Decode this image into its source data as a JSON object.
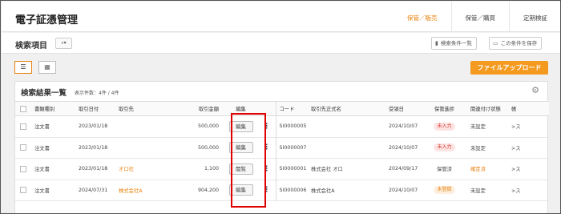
{
  "header": {
    "title": "電子証憑管理",
    "nav": [
      {
        "label": "保管／販売",
        "active": true
      },
      {
        "label": "保管／購買",
        "active": false
      },
      {
        "label": "定期検証",
        "active": false
      }
    ]
  },
  "search": {
    "title": "検索項目",
    "toggle_icon": "search-dropdown",
    "list_button": "検索条件一覧",
    "save_button": "この条件を保存"
  },
  "toolbar": {
    "upload_button": "ファイルアップロード"
  },
  "results": {
    "title": "検索結果一覧",
    "count_label": "表示件数：4件 / 4件",
    "columns": [
      "",
      "書類種別",
      "取引日付",
      "取引先",
      "取引金額",
      "編集",
      "",
      "コード",
      "取引先正式名",
      "受領日",
      "保管進捗",
      "関連付け状態",
      "帳"
    ],
    "rows": [
      {
        "doc_type": "注文書",
        "date": "2023/01/18",
        "partner": "",
        "amount": "500,000",
        "action": "編集",
        "code": "SI0000005",
        "official_name": "",
        "received": "2024/10/07",
        "progress": "未入力",
        "progress_style": "red",
        "link_status": "未設定",
        "link_style": "normal",
        "more": ">ス"
      },
      {
        "doc_type": "注文書",
        "date": "2023/01/18",
        "partner": "",
        "amount": "500,000",
        "action": "編集",
        "code": "SI0000007",
        "official_name": "",
        "received": "2024/10/07",
        "progress": "未入力",
        "progress_style": "red",
        "link_status": "未設定",
        "link_style": "normal",
        "more": ">ス"
      },
      {
        "doc_type": "注文書",
        "date": "2023/01/18",
        "partner": "オロ社",
        "amount": "1,100",
        "action": "閲覧",
        "code": "SI0000001",
        "official_name": "株式会社 オロ",
        "received": "2024/09/17",
        "progress": "保管済",
        "progress_style": "plain",
        "link_status": "確定済",
        "link_style": "orange",
        "more": ">ス"
      },
      {
        "doc_type": "注文書",
        "date": "2024/07/31",
        "partner": "株式会社A",
        "amount": "904,200",
        "action": "編集",
        "code": "SI0000006",
        "official_name": "株式会社A",
        "received": "2024/10/07",
        "progress": "未登録",
        "progress_style": "orange",
        "link_status": "未設定",
        "link_style": "normal",
        "more": ">ス"
      }
    ]
  },
  "colors": {
    "accent": "#f39a1f",
    "highlight": "#e00000"
  }
}
